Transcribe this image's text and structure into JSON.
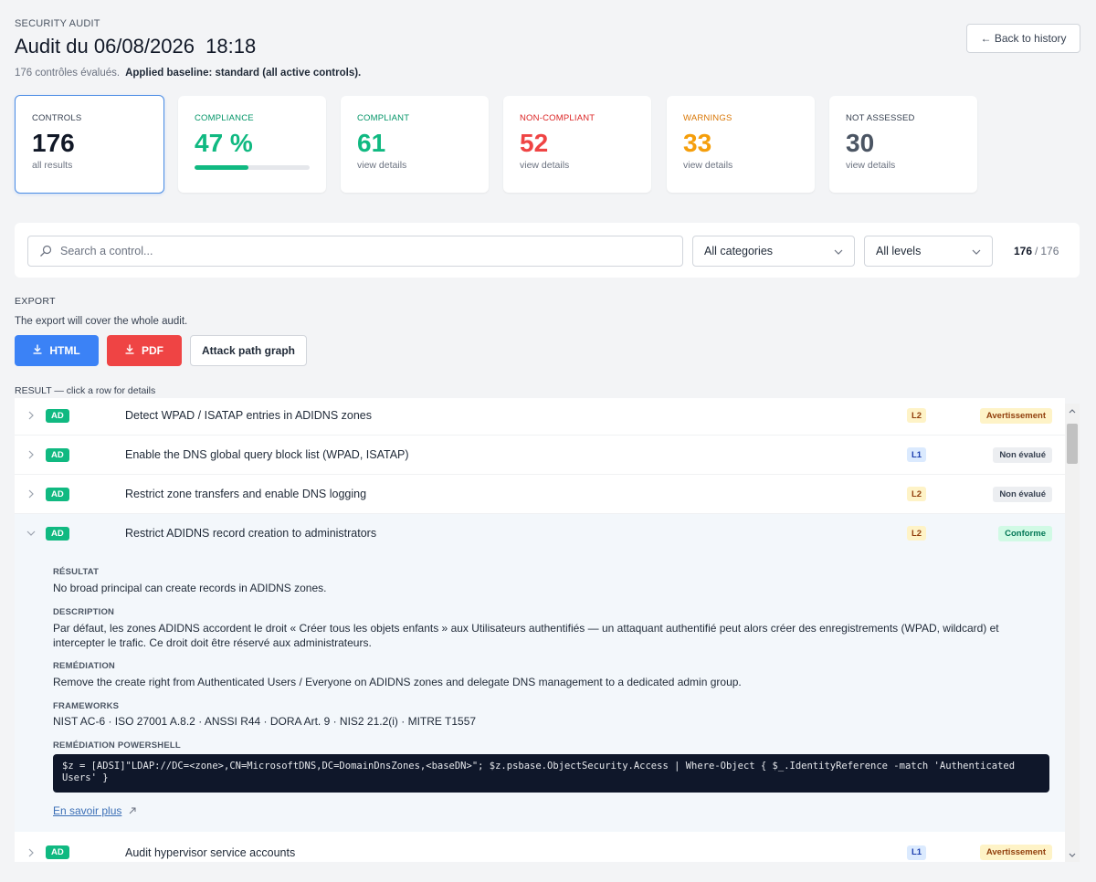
{
  "header": {
    "eyebrow": "SECURITY AUDIT",
    "title": "Audit du 06/08/2026  18:18",
    "evaluated": "176 contrôles évalués.",
    "baseline": "Applied baseline: standard (all active controls).",
    "back_label": "← Back to history"
  },
  "kpis": [
    {
      "label": "CONTROLS",
      "value": "176",
      "sub": "all results",
      "color": "#111827"
    },
    {
      "label": "COMPLIANCE",
      "value": "47 %",
      "progress": 0.47,
      "color": "#10b981"
    },
    {
      "label": "COMPLIANT",
      "value": "61",
      "sub": "view details",
      "color": "#10b981"
    },
    {
      "label": "NON-COMPLIANT",
      "value": "52",
      "sub": "view details",
      "color": "#ef4444"
    },
    {
      "label": "WARNINGS",
      "value": "33",
      "sub": "view details",
      "color": "#f59e0b"
    },
    {
      "label": "NOT ASSESSED",
      "value": "30",
      "sub": "view details",
      "color": "#4b5563"
    }
  ],
  "filters": {
    "search_placeholder": "Search a control...",
    "category": "All categories",
    "level": "All levels",
    "shown": "176",
    "total": "176"
  },
  "export": {
    "label": "EXPORT",
    "note": "The export will cover the whole audit.",
    "html_label": "HTML",
    "pdf_label": "PDF",
    "graph_label": "Attack path graph"
  },
  "results": {
    "label": "RESULT — click a row for details",
    "rows": [
      {
        "tag": "AD",
        "title": "Detect WPAD / ISATAP entries in ADIDNS zones",
        "level": "L2",
        "status": "Avertissement"
      },
      {
        "tag": "AD",
        "title": "Enable the DNS global query block list (WPAD, ISATAP)",
        "level": "L1",
        "status": "Non évalué"
      },
      {
        "tag": "AD",
        "title": "Restrict zone transfers and enable DNS logging",
        "level": "L2",
        "status": "Non évalué"
      },
      {
        "tag": "AD",
        "title": "Restrict ADIDNS record creation to administrators",
        "level": "L2",
        "status": "Conforme"
      },
      {
        "tag": "AD",
        "title": "Audit hypervisor service accounts",
        "level": "L1",
        "status": "Avertissement"
      }
    ],
    "detail": {
      "result_h": "RÉSULTAT",
      "result": "No broad principal can create records in ADIDNS zones.",
      "desc_h": "DESCRIPTION",
      "desc": "Par défaut, les zones ADIDNS accordent le droit « Créer tous les objets enfants » aux Utilisateurs authentifiés — un attaquant authentifié peut alors créer des enregistrements (WPAD, wildcard) et intercepter le trafic. Ce droit doit être réservé aux administrateurs.",
      "rem_h": "REMÉDIATION",
      "rem": "Remove the create right from Authenticated Users / Everyone on ADIDNS zones and delegate DNS management to a dedicated admin group.",
      "fw_h": "FRAMEWORKS",
      "fw": "NIST AC-6 · ISO 27001 A.8.2 · ANSSI R44 · DORA Art. 9 · NIS2 21.2(i) · MITRE T1557",
      "ps_h": "REMÉDIATION POWERSHELL",
      "ps": "$z = [ADSI]\"LDAP://DC=<zone>,CN=MicrosoftDNS,DC=DomainDnsZones,<baseDN>\"; $z.psbase.ObjectSecurity.Access | Where-Object { $_.IdentityReference -match 'Authenticated Users' }",
      "more": "En savoir plus"
    }
  }
}
